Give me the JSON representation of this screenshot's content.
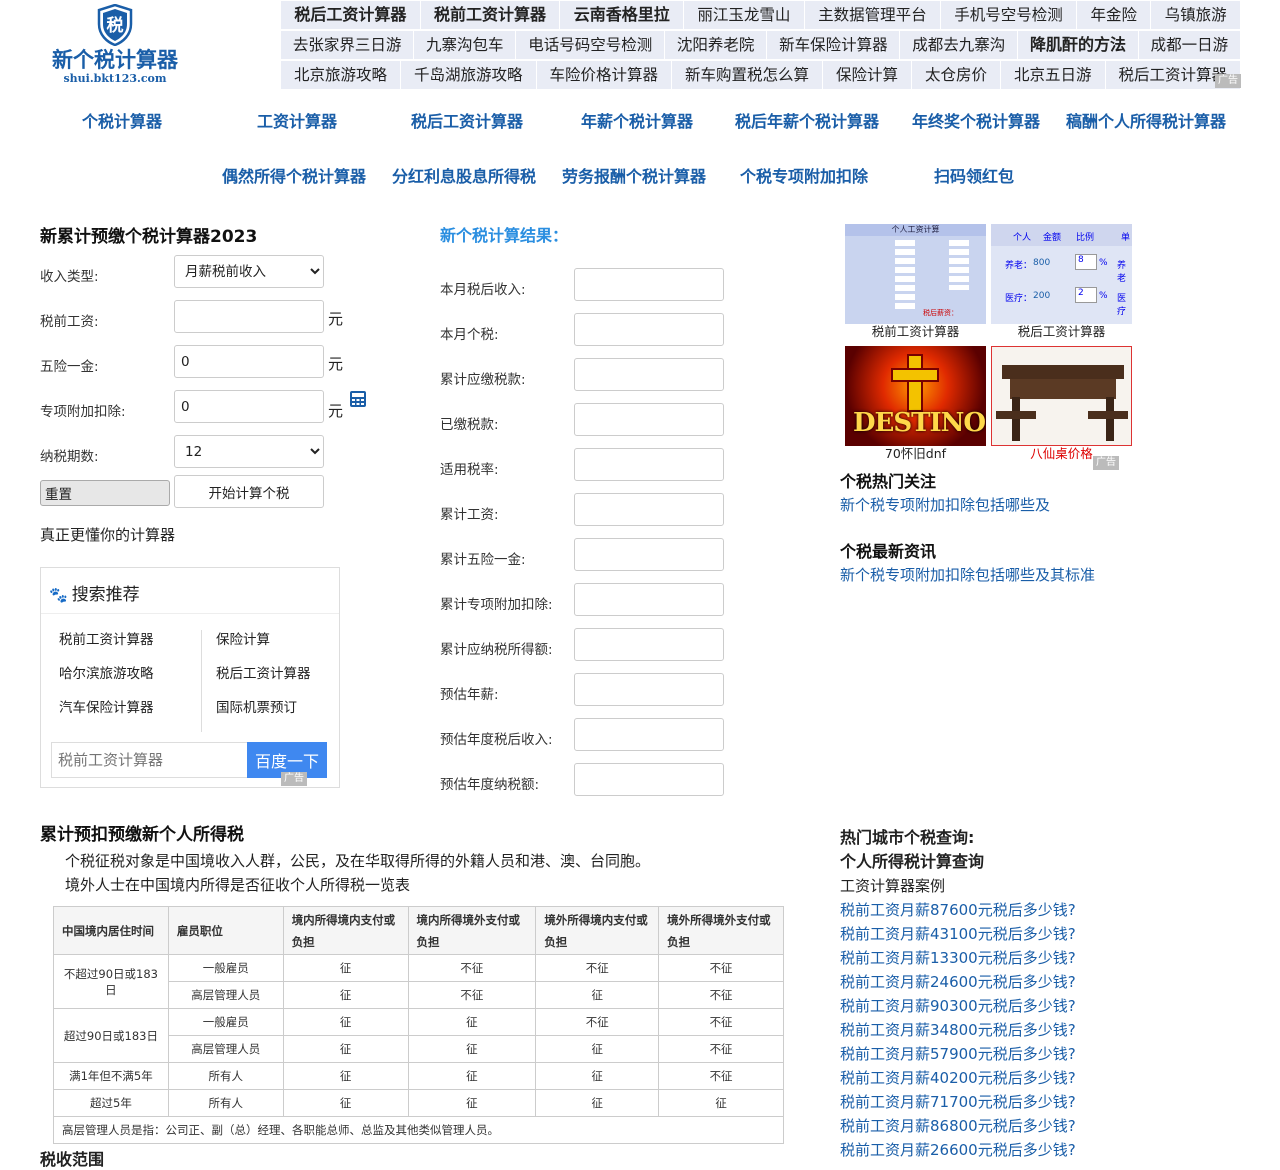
{
  "logo": {
    "brand": "新个税计算器",
    "url": "shui.bkt123.com",
    "icon": "shield-tax-icon",
    "glyph": "税",
    "color": "#1a5ea8"
  },
  "ad_links": {
    "rows": [
      [
        {
          "label": "税后工资计算器",
          "bold": true
        },
        {
          "label": "税前工资计算器",
          "bold": true
        },
        {
          "label": "云南香格里拉",
          "bold": true
        },
        {
          "label": "丽江玉龙雪山"
        },
        {
          "label": "主数据管理平台"
        },
        {
          "label": "手机号空号检测"
        },
        {
          "label": "年金险"
        },
        {
          "label": "乌镇旅游"
        }
      ],
      [
        {
          "label": "去张家界三日游"
        },
        {
          "label": "九寨沟包车"
        },
        {
          "label": "电话号码空号检测"
        },
        {
          "label": "沈阳养老院"
        },
        {
          "label": "新车保险计算器"
        },
        {
          "label": "成都去九寨沟"
        },
        {
          "label": "降肌酐的方法",
          "bold": true
        },
        {
          "label": "成都一日游"
        }
      ],
      [
        {
          "label": "北京旅游攻略"
        },
        {
          "label": "千岛湖旅游攻略"
        },
        {
          "label": "车险价格计算器"
        },
        {
          "label": "新车购置税怎么算"
        },
        {
          "label": "保险计算"
        },
        {
          "label": "太仓房价"
        },
        {
          "label": "北京五日游"
        },
        {
          "label": "税后工资计算器"
        }
      ]
    ],
    "badge": "广告"
  },
  "nav": {
    "row1": [
      "个税计算器",
      "工资计算器",
      "税后工资计算器",
      "年薪个税计算器",
      "税后年薪个税计算器",
      "年终奖个税计算器",
      "稿酬个人所得税计算器"
    ],
    "row2": [
      "偶然所得个税计算器",
      "分红利息股息所得税",
      "劳务报酬个税计算器",
      "个税专项附加扣除",
      "扫码领红包"
    ]
  },
  "calculator": {
    "title": "新累计预缴个税计算器2023",
    "income_type_label": "收入类型:",
    "income_type_value": "月薪税前收入",
    "salary_label": "税前工资:",
    "salary_value": "",
    "insurance_label": "五险一金:",
    "insurance_value": "0",
    "deduction_label": "专项附加扣除:",
    "deduction_value": "0",
    "periods_label": "纳税期数:",
    "periods_value": "12",
    "unit": "元",
    "reset": "重置",
    "submit": "开始计算个税",
    "tagline": "真正更懂你的计算器"
  },
  "search": {
    "title": "搜索推荐",
    "items": [
      "税前工资计算器",
      "保险计算",
      "哈尔滨旅游攻略",
      "税后工资计算器",
      "汽车保险计算器",
      "国际机票预订"
    ],
    "placeholder": "税前工资计算器",
    "button": "百度一下",
    "badge": "广告"
  },
  "result": {
    "title": "新个税计算结果：",
    "fields": [
      "本月税后收入:",
      "本月个税:",
      "累计应缴税款:",
      "已缴税款:",
      "适用税率:",
      "累计工资:",
      "累计五险一金:",
      "累计专项附加扣除:",
      "累计应纳税所得额:",
      "预估年薪:",
      "预估年度税后收入:",
      "预估年度纳税额:"
    ]
  },
  "thumbs": [
    {
      "caption": "税前工资计算器",
      "caption_color": "#222"
    },
    {
      "caption": "税后工资计算器",
      "caption_color": "#222"
    },
    {
      "caption": "70怀旧dnf",
      "caption_color": "#222",
      "logo_text": "DESTINO"
    },
    {
      "caption": "八仙桌价格",
      "caption_color": "#d00"
    }
  ],
  "thumbs_badge": "广告",
  "thumb_screens": {
    "pre": {
      "title": "个人工资计算",
      "result": "税后薪资："
    },
    "post": {
      "header": [
        "个人",
        "金额",
        "比例",
        "单"
      ],
      "rows": [
        {
          "label": "养老：",
          "amount": "800",
          "rate": "8",
          "unit": "%",
          "extra": "养老"
        },
        {
          "label": "医疗：",
          "amount": "200",
          "rate": "2",
          "unit": "%",
          "extra": "医疗"
        }
      ]
    }
  },
  "hot": {
    "title": "个税热门关注",
    "link": "新个税专项附加扣除包括哪些及"
  },
  "news": {
    "title": "个税最新资讯",
    "link": "新个税专项附加扣除包括哪些及其标准"
  },
  "article": {
    "title": "累计预扣预缴新个人所得税",
    "p1": "个税征税对象是中国境收入人群，公民，及在华取得所得的外籍人员和港、澳、台同胞。",
    "p2": "境外人士在中国境内所得是否征收个人所得税一览表",
    "table": {
      "headers": [
        "中国境内居住时间",
        "雇员职位",
        "境内所得境内支付或负担",
        "境内所得境外支付或负担",
        "境外所得境内支付或负担",
        "境外所得境外支付或负担"
      ],
      "rows": [
        {
          "period": "不超过90日或183日",
          "rowspan": 2,
          "position": "一般雇员",
          "cells": [
            "征",
            "不征",
            "不征",
            "不征"
          ]
        },
        {
          "position": "高层管理人员",
          "cells": [
            "征",
            "不征",
            "征",
            "不征"
          ]
        },
        {
          "period": "超过90日或183日",
          "rowspan": 2,
          "position": "一般雇员",
          "cells": [
            "征",
            "征",
            "不征",
            "不征"
          ]
        },
        {
          "position": "高层管理人员",
          "cells": [
            "征",
            "征",
            "征",
            "不征"
          ]
        },
        {
          "period": "满1年但不满5年",
          "rowspan": 1,
          "position": "所有人",
          "cells": [
            "征",
            "征",
            "征",
            "不征"
          ]
        },
        {
          "period": "超过5年",
          "rowspan": 1,
          "position": "所有人",
          "cells": [
            "征",
            "征",
            "征",
            "征"
          ]
        }
      ],
      "footnote": "高层管理人员是指：公司正、副（总）经理、各职能总师、总监及其他类似管理人员。"
    },
    "scope_title": "税收范围"
  },
  "cities": {
    "title1": "热门城市个税查询:",
    "title2": "个人所得税计算查询",
    "title3": "工资计算器案例",
    "links": [
      "税前工资月薪87600元税后多少钱?",
      "税前工资月薪43100元税后多少钱?",
      "税前工资月薪13300元税后多少钱?",
      "税前工资月薪24600元税后多少钱?",
      "税前工资月薪90300元税后多少钱?",
      "税前工资月薪34800元税后多少钱?",
      "税前工资月薪57900元税后多少钱?",
      "税前工资月薪40200元税后多少钱?",
      "税前工资月薪71700元税后多少钱?",
      "税前工资月薪86800元税后多少钱?",
      "税前工资月薪26600元税后多少钱?"
    ]
  }
}
